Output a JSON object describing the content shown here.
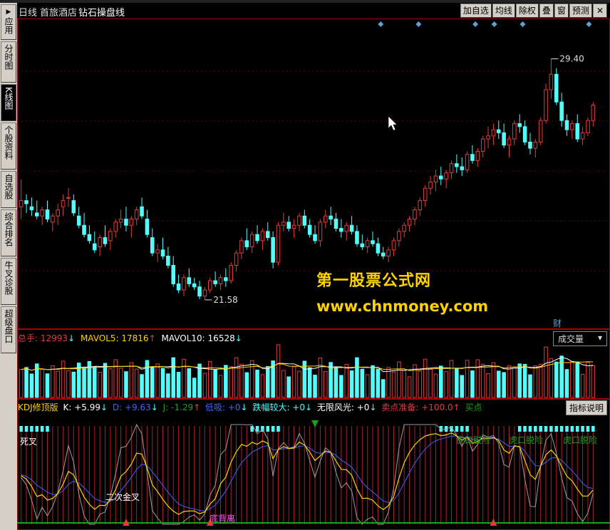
{
  "side_tabs": [
    {
      "label": "应用",
      "arrow": "▶",
      "active": false
    },
    {
      "label": "分时图",
      "active": false
    },
    {
      "label": "K线图",
      "active": true
    },
    {
      "label": "个股资料",
      "active": false
    },
    {
      "label": "自选股",
      "active": false
    },
    {
      "label": "综合排名",
      "active": false
    },
    {
      "label": "牛叉诊股",
      "active": false
    },
    {
      "label": "超级盘口",
      "active": false
    }
  ],
  "header": {
    "period": "日线",
    "stock": "首旅酒店",
    "indicator": "钻石操盘线",
    "buttons": [
      "加自选",
      "均线",
      "除权",
      "叠",
      "窗",
      "预测"
    ],
    "cursor_icon": "arrow-cursor-icon"
  },
  "price_panel": {
    "high_label": "29.40",
    "low_label": "21.58",
    "cai_label": "财",
    "watermark_cn": "第一股票公式网",
    "watermark_url": "www.chnmoney.com"
  },
  "volume_panel": {
    "total_label": "总手:",
    "total_value": "12993",
    "mavol5_label": "MAVOL5:",
    "mavol5_value": "17816",
    "mavol10_label": "MAVOL10:",
    "mavol10_value": "16528",
    "selector": "成交量"
  },
  "kdj_panel": {
    "name": "KDJ修顶版",
    "k": "K: +5.99",
    "d": "D: +9.63",
    "j": "J: -1.29",
    "low": "低吸: +0",
    "drop": "跌幅较大: +0",
    "scenic": "无限风光: +0",
    "sell": "卖点准备: +100.0",
    "buy": "买点",
    "explain": "指标说明",
    "ann_deadcross": "死叉",
    "ann_second_gold": "二次金叉",
    "ann_divergence": "底背离",
    "ann_tiger1": "虎口脱险",
    "ann_tiger2": "虎口脱险",
    "ann_tiger3": "虎口脱险"
  },
  "colors": {
    "up": "#e43c3c",
    "down": "#54fcfc",
    "yellow": "#ffd200",
    "white": "#ffffff",
    "marker": "#5aa0dc"
  },
  "chart_data": {
    "type": "candlestick",
    "candles": [
      [
        24.6,
        25.5,
        24.2,
        24.8
      ],
      [
        24.8,
        25.0,
        24.4,
        24.7
      ],
      [
        24.6,
        24.9,
        24.3,
        24.5
      ],
      [
        24.4,
        24.8,
        24.2,
        24.3
      ],
      [
        24.3,
        24.6,
        24.0,
        24.5
      ],
      [
        24.5,
        24.8,
        24.1,
        24.2
      ],
      [
        24.1,
        24.4,
        23.8,
        24.3
      ],
      [
        24.3,
        24.7,
        24.0,
        24.5
      ],
      [
        24.6,
        25.0,
        24.3,
        24.8
      ],
      [
        24.9,
        25.2,
        24.6,
        24.9
      ],
      [
        24.8,
        25.0,
        24.3,
        24.4
      ],
      [
        24.3,
        24.6,
        23.9,
        24.0
      ],
      [
        24.0,
        24.4,
        23.6,
        23.7
      ],
      [
        23.7,
        24.0,
        23.4,
        23.5
      ],
      [
        23.4,
        23.8,
        23.1,
        23.2
      ],
      [
        23.3,
        23.7,
        23.0,
        23.6
      ],
      [
        23.6,
        24.0,
        23.3,
        23.4
      ],
      [
        23.5,
        23.9,
        23.2,
        23.8
      ],
      [
        23.8,
        24.2,
        23.6,
        24.1
      ],
      [
        24.1,
        24.5,
        23.9,
        24.2
      ],
      [
        24.2,
        24.6,
        23.8,
        24.0
      ],
      [
        24.0,
        24.3,
        23.6,
        24.2
      ],
      [
        24.2,
        24.6,
        24.0,
        24.5
      ],
      [
        24.6,
        24.9,
        24.2,
        24.3
      ],
      [
        24.2,
        24.5,
        23.6,
        23.7
      ],
      [
        23.6,
        23.9,
        23.0,
        23.1
      ],
      [
        23.1,
        23.4,
        22.8,
        23.2
      ],
      [
        23.2,
        23.6,
        22.9,
        23.0
      ],
      [
        23.0,
        23.3,
        22.6,
        22.7
      ],
      [
        22.7,
        23.0,
        22.0,
        22.1
      ],
      [
        22.1,
        22.4,
        21.8,
        21.9
      ],
      [
        21.9,
        22.4,
        21.7,
        22.3
      ],
      [
        22.3,
        22.6,
        22.0,
        22.1
      ],
      [
        22.1,
        22.3,
        21.9,
        22.0
      ],
      [
        22.0,
        22.2,
        21.6,
        21.7
      ],
      [
        21.7,
        22.0,
        21.58,
        21.9
      ],
      [
        21.9,
        22.3,
        21.8,
        22.2
      ],
      [
        22.2,
        22.5,
        22.0,
        22.1
      ],
      [
        22.1,
        22.4,
        21.9,
        22.3
      ],
      [
        22.3,
        22.6,
        22.0,
        22.2
      ],
      [
        22.2,
        22.8,
        22.1,
        22.7
      ],
      [
        22.7,
        23.2,
        22.5,
        23.1
      ],
      [
        23.1,
        23.6,
        22.9,
        23.5
      ],
      [
        23.5,
        23.9,
        23.2,
        23.3
      ],
      [
        23.3,
        23.8,
        23.1,
        23.7
      ],
      [
        23.7,
        24.0,
        23.4,
        23.5
      ],
      [
        23.5,
        23.9,
        23.2,
        23.8
      ],
      [
        23.8,
        24.1,
        23.5,
        23.6
      ],
      [
        23.6,
        23.8,
        22.6,
        22.8
      ],
      [
        22.8,
        24.1,
        22.7,
        24.0
      ],
      [
        24.0,
        24.4,
        23.8,
        24.1
      ],
      [
        24.1,
        24.3,
        23.8,
        23.9
      ],
      [
        23.9,
        24.2,
        23.6,
        24.0
      ],
      [
        24.0,
        24.4,
        23.8,
        24.3
      ],
      [
        24.3,
        24.5,
        23.9,
        24.0
      ],
      [
        24.0,
        24.2,
        23.6,
        23.7
      ],
      [
        23.7,
        24.0,
        23.4,
        23.5
      ],
      [
        23.5,
        24.2,
        23.3,
        24.1
      ],
      [
        24.1,
        24.5,
        23.9,
        24.3
      ],
      [
        24.3,
        24.6,
        24.0,
        24.2
      ],
      [
        24.2,
        24.4,
        23.8,
        23.9
      ],
      [
        23.9,
        24.2,
        23.6,
        23.8
      ],
      [
        23.8,
        24.1,
        23.5,
        24.0
      ],
      [
        24.0,
        24.3,
        23.7,
        23.8
      ],
      [
        23.8,
        24.0,
        23.3,
        23.4
      ],
      [
        23.4,
        23.7,
        23.2,
        23.3
      ],
      [
        23.3,
        23.6,
        23.1,
        23.5
      ],
      [
        23.5,
        23.8,
        23.3,
        23.4
      ],
      [
        23.4,
        23.6,
        23.0,
        23.1
      ],
      [
        23.1,
        23.3,
        22.9,
        23.0
      ],
      [
        23.0,
        23.3,
        22.8,
        23.2
      ],
      [
        23.2,
        23.6,
        23.0,
        23.5
      ],
      [
        23.5,
        23.9,
        23.3,
        23.8
      ],
      [
        23.8,
        24.1,
        23.6,
        24.0
      ],
      [
        24.0,
        24.3,
        23.8,
        24.2
      ],
      [
        24.2,
        24.6,
        24.0,
        24.5
      ],
      [
        24.5,
        24.9,
        24.3,
        24.8
      ],
      [
        24.8,
        25.3,
        24.6,
        25.2
      ],
      [
        25.2,
        25.6,
        25.0,
        25.4
      ],
      [
        25.4,
        25.8,
        25.1,
        25.6
      ],
      [
        25.6,
        25.9,
        25.3,
        25.5
      ],
      [
        25.5,
        25.8,
        25.2,
        25.7
      ],
      [
        25.7,
        26.1,
        25.5,
        26.0
      ],
      [
        26.0,
        26.3,
        25.7,
        25.9
      ],
      [
        25.9,
        26.2,
        25.6,
        25.8
      ],
      [
        25.8,
        26.4,
        25.7,
        26.3
      ],
      [
        26.3,
        26.6,
        26.0,
        26.1
      ],
      [
        26.1,
        26.5,
        25.9,
        26.4
      ],
      [
        26.4,
        26.9,
        26.2,
        26.8
      ],
      [
        26.8,
        27.2,
        26.5,
        26.9
      ],
      [
        26.9,
        27.3,
        26.6,
        27.1
      ],
      [
        27.1,
        27.4,
        26.8,
        27.0
      ],
      [
        27.0,
        27.3,
        26.5,
        26.6
      ],
      [
        26.6,
        26.9,
        26.2,
        26.8
      ],
      [
        26.8,
        27.4,
        26.6,
        27.3
      ],
      [
        27.3,
        27.6,
        27.0,
        27.2
      ],
      [
        27.2,
        27.4,
        26.6,
        26.7
      ],
      [
        26.7,
        27.0,
        26.3,
        26.5
      ],
      [
        26.5,
        26.8,
        26.2,
        26.7
      ],
      [
        26.7,
        27.5,
        26.6,
        27.4
      ],
      [
        27.4,
        28.6,
        27.3,
        28.4
      ],
      [
        28.4,
        29.4,
        28.1,
        28.9
      ],
      [
        28.9,
        29.1,
        27.9,
        28.0
      ],
      [
        28.0,
        28.3,
        27.2,
        27.4
      ],
      [
        27.4,
        27.6,
        26.9,
        27.1
      ],
      [
        27.1,
        27.4,
        26.8,
        27.3
      ],
      [
        27.3,
        27.6,
        26.7,
        26.8
      ],
      [
        26.8,
        27.2,
        26.6,
        27.0
      ],
      [
        27.0,
        27.5,
        26.9,
        27.4
      ],
      [
        27.4,
        28.0,
        27.2,
        27.9
      ]
    ]
  }
}
